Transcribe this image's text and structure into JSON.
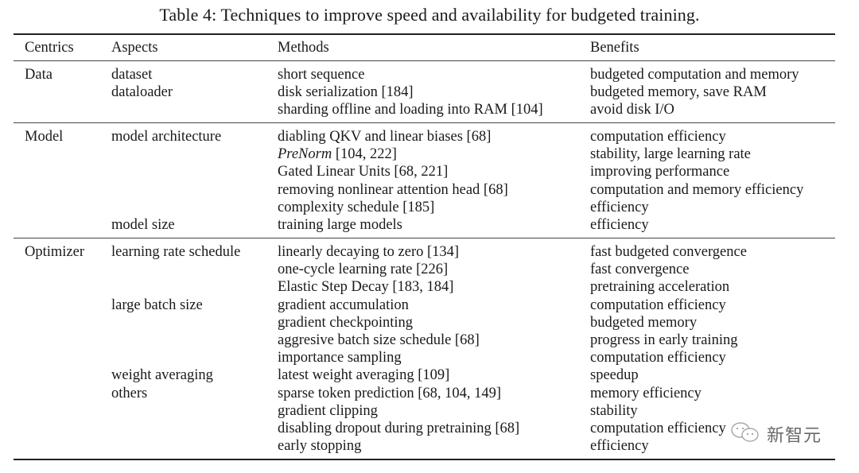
{
  "caption": "Table 4: Techniques to improve speed and availability for budgeted training.",
  "headers": [
    "Centrics",
    "Aspects",
    "Methods",
    "Benefits"
  ],
  "sections": [
    {
      "centric": "Data",
      "rows": [
        {
          "aspect": "dataset",
          "method": "short sequence",
          "benefit": "budgeted computation and memory"
        },
        {
          "aspect": "dataloader",
          "method": "disk serialization [184]",
          "benefit": "budgeted memory, save RAM"
        },
        {
          "aspect": "",
          "method": "sharding offline and loading into RAM [104]",
          "benefit": "avoid disk I/O"
        }
      ]
    },
    {
      "centric": "Model",
      "rows": [
        {
          "aspect": "model architecture",
          "method": "diabling QKV and linear biases [68]",
          "benefit": "computation efficiency"
        },
        {
          "aspect": "",
          "method_italic": "PreNorm",
          "method": " [104, 222]",
          "benefit": "stability, large learning rate"
        },
        {
          "aspect": "",
          "method": "Gated Linear Units [68, 221]",
          "benefit": "improving performance"
        },
        {
          "aspect": "",
          "method": "removing nonlinear attention head [68]",
          "benefit": "computation and memory efficiency"
        },
        {
          "aspect": "",
          "method": "complexity schedule [185]",
          "benefit": "efficiency"
        },
        {
          "aspect": "model size",
          "method": "training large models",
          "benefit": "efficiency"
        }
      ]
    },
    {
      "centric": "Optimizer",
      "rows": [
        {
          "aspect": "learning rate schedule",
          "method": "linearly decaying to zero [134]",
          "benefit": "fast budgeted convergence"
        },
        {
          "aspect": "",
          "method": "one-cycle learning rate [226]",
          "benefit": "fast convergence"
        },
        {
          "aspect": "",
          "method": "Elastic Step Decay [183, 184]",
          "benefit": "pretraining acceleration"
        },
        {
          "aspect": "large batch size",
          "method": "gradient accumulation",
          "benefit": "computation efficiency"
        },
        {
          "aspect": "",
          "method": "gradient checkpointing",
          "benefit": "budgeted memory"
        },
        {
          "aspect": "",
          "method": "aggresive batch size schedule [68]",
          "benefit": "progress in early training"
        },
        {
          "aspect": "",
          "method": "importance sampling",
          "benefit": "computation efficiency"
        },
        {
          "aspect": "weight averaging",
          "method": "latest weight averaging [109]",
          "benefit": "speedup"
        },
        {
          "aspect": "others",
          "method": "sparse token prediction [68, 104, 149]",
          "benefit": "memory efficiency"
        },
        {
          "aspect": "",
          "method": "gradient clipping",
          "benefit": "stability"
        },
        {
          "aspect": "",
          "method": "disabling dropout during pretraining [68]",
          "benefit": "computation efficiency"
        },
        {
          "aspect": "",
          "method": "early stopping",
          "benefit": "efficiency"
        }
      ]
    }
  ],
  "watermark": {
    "icon": "wechat-icon",
    "text": "新智元"
  }
}
